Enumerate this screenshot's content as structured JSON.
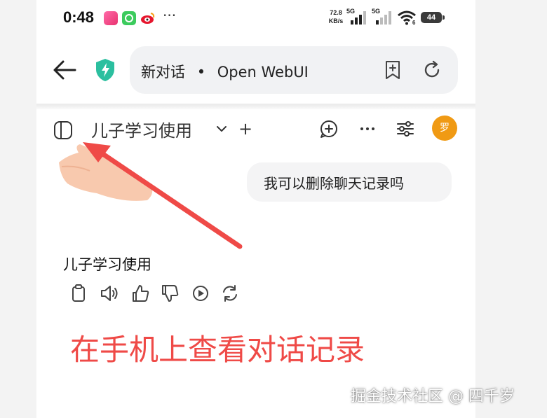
{
  "status_bar": {
    "time": "0:48",
    "dots": "···",
    "net_speed_value": "72.8",
    "net_speed_unit": "KB/s",
    "sim1_label": "5G",
    "sim2_label": "5G",
    "wifi_badge": "6",
    "battery": "44"
  },
  "browser": {
    "page_title": "新对话",
    "separator": "•",
    "site_name": "Open WebUI"
  },
  "chat_header": {
    "model_name": "儿子学习使用",
    "plus_label": "+",
    "avatar_initial": "罗"
  },
  "messages": {
    "user": "我可以删除聊天记录吗",
    "assistant": "儿子学习使用"
  },
  "annotation": {
    "caption": "在手机上查看对话记录",
    "watermark": "掘金技术社区 @ 四千岁"
  },
  "colors": {
    "accent_orange": "#f09a14",
    "annotation_red": "#ef4a47",
    "shield_teal": "#2bbf9f"
  }
}
